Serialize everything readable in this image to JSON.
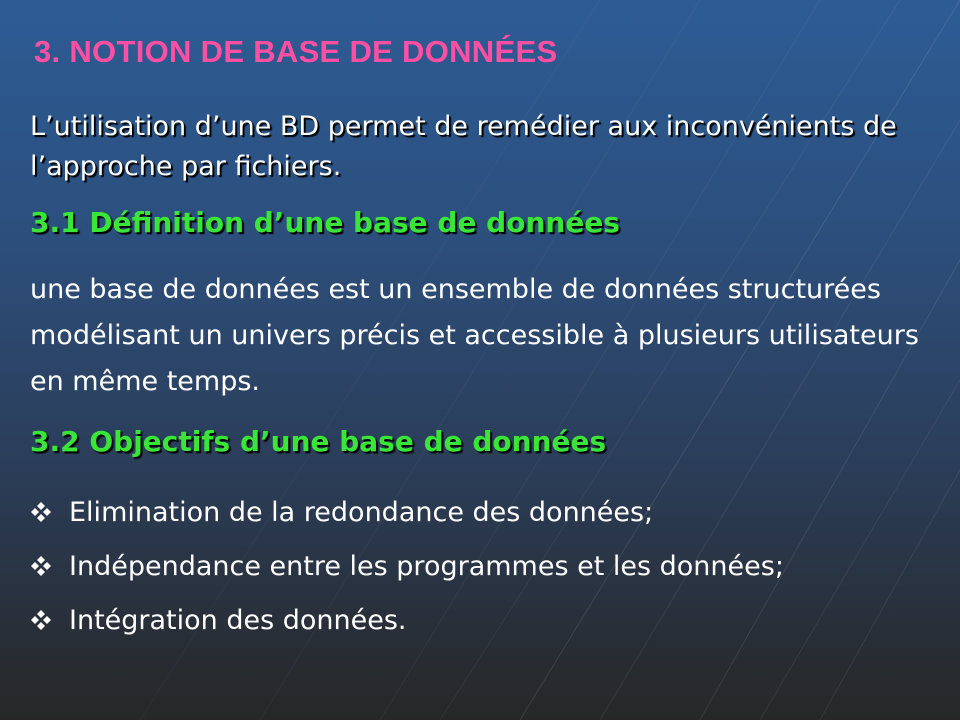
{
  "slide": {
    "title": "3. NOTION DE BASE DE DONNÉES",
    "intro": "L’utilisation d’une BD permet de remédier aux inconvénients de l’approche par fichiers.",
    "section_1": {
      "heading": "3.1 Définition d’une base de données",
      "body": "une base de données est un ensemble de données structurées modélisant un univers précis et accessible à plusieurs utilisateurs en même temps."
    },
    "section_2": {
      "heading": "3.2 Objectifs d’une base de données",
      "bullets": [
        {
          "icon": "four-diamond-bullet-icon",
          "text": "Elimination de la redondance des données;"
        },
        {
          "icon": "four-diamond-bullet-icon",
          "text": "Indépendance entre les programmes et les données;"
        },
        {
          "icon": "four-diamond-bullet-icon",
          "text": "Intégration des données."
        }
      ]
    }
  },
  "colors": {
    "title": "#ff4fa3",
    "heading": "#39e637",
    "body_text": "#ffffff",
    "background_top": "#2d5c95",
    "background_bottom": "#272727"
  }
}
